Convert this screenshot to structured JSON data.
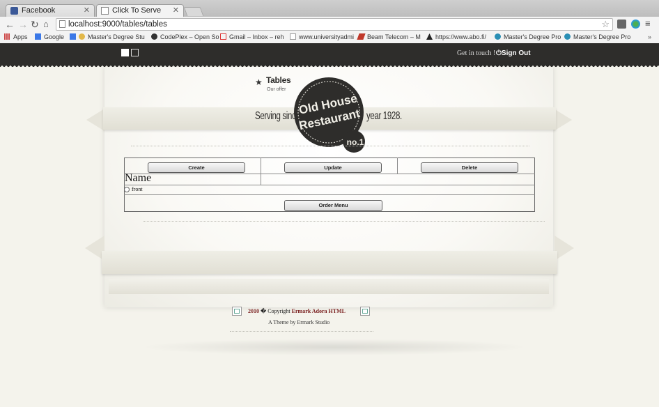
{
  "browser": {
    "tabs": [
      {
        "title": "Facebook",
        "active": false
      },
      {
        "title": "Click To Serve",
        "active": true
      }
    ],
    "address": {
      "url": "localhost:9000/tables/tables"
    },
    "bookmarks": [
      {
        "label": "Apps",
        "icon": "apps-grid-icon"
      },
      {
        "label": "Google",
        "icon": "google-icon"
      },
      {
        "label": "Master's Degree Stu",
        "icon": "bookmark-icon"
      },
      {
        "label": "CodePlex – Open So",
        "icon": "codeplex-icon"
      },
      {
        "label": "Gmail – Inbox – reh",
        "icon": "gmail-icon"
      },
      {
        "label": "www.universityadmi",
        "icon": "page-icon"
      },
      {
        "label": "Beam Telecom – M",
        "icon": "beam-icon"
      },
      {
        "label": "https://www.abo.fi/",
        "icon": "abo-icon"
      },
      {
        "label": "Master's Degree Pro",
        "icon": "bookmark-icon"
      },
      {
        "label": "Master's Degree Pro",
        "icon": "bookmark-icon"
      }
    ]
  },
  "site": {
    "topbar": {
      "get_in_touch": "Get in touch !",
      "sign_out": "Sign Out"
    },
    "header": {
      "title": "Tables",
      "subtitle": "Our offer"
    },
    "banner": {
      "left": "Serving since",
      "right": "year 1928."
    },
    "logo": {
      "line1": "Old House",
      "line2": "Restaurant",
      "badge": "no.1"
    },
    "actions": {
      "create": "Create",
      "update": "Update",
      "delete": "Delete"
    },
    "table": {
      "header": "Name",
      "rows": [
        {
          "label": "front",
          "selected": false
        }
      ]
    },
    "order_button": "Order Menu",
    "footer": {
      "year": "2010",
      "copyright_symbol": "�",
      "copyright": "Copyright",
      "brand": "Ermark Adora HTML",
      "theme": "A Theme by Ermark Studio"
    }
  },
  "colors": {
    "topbar": "#2e2d2b",
    "page_background": "#f4f3ec",
    "footer_link": "#7a1f1f"
  }
}
